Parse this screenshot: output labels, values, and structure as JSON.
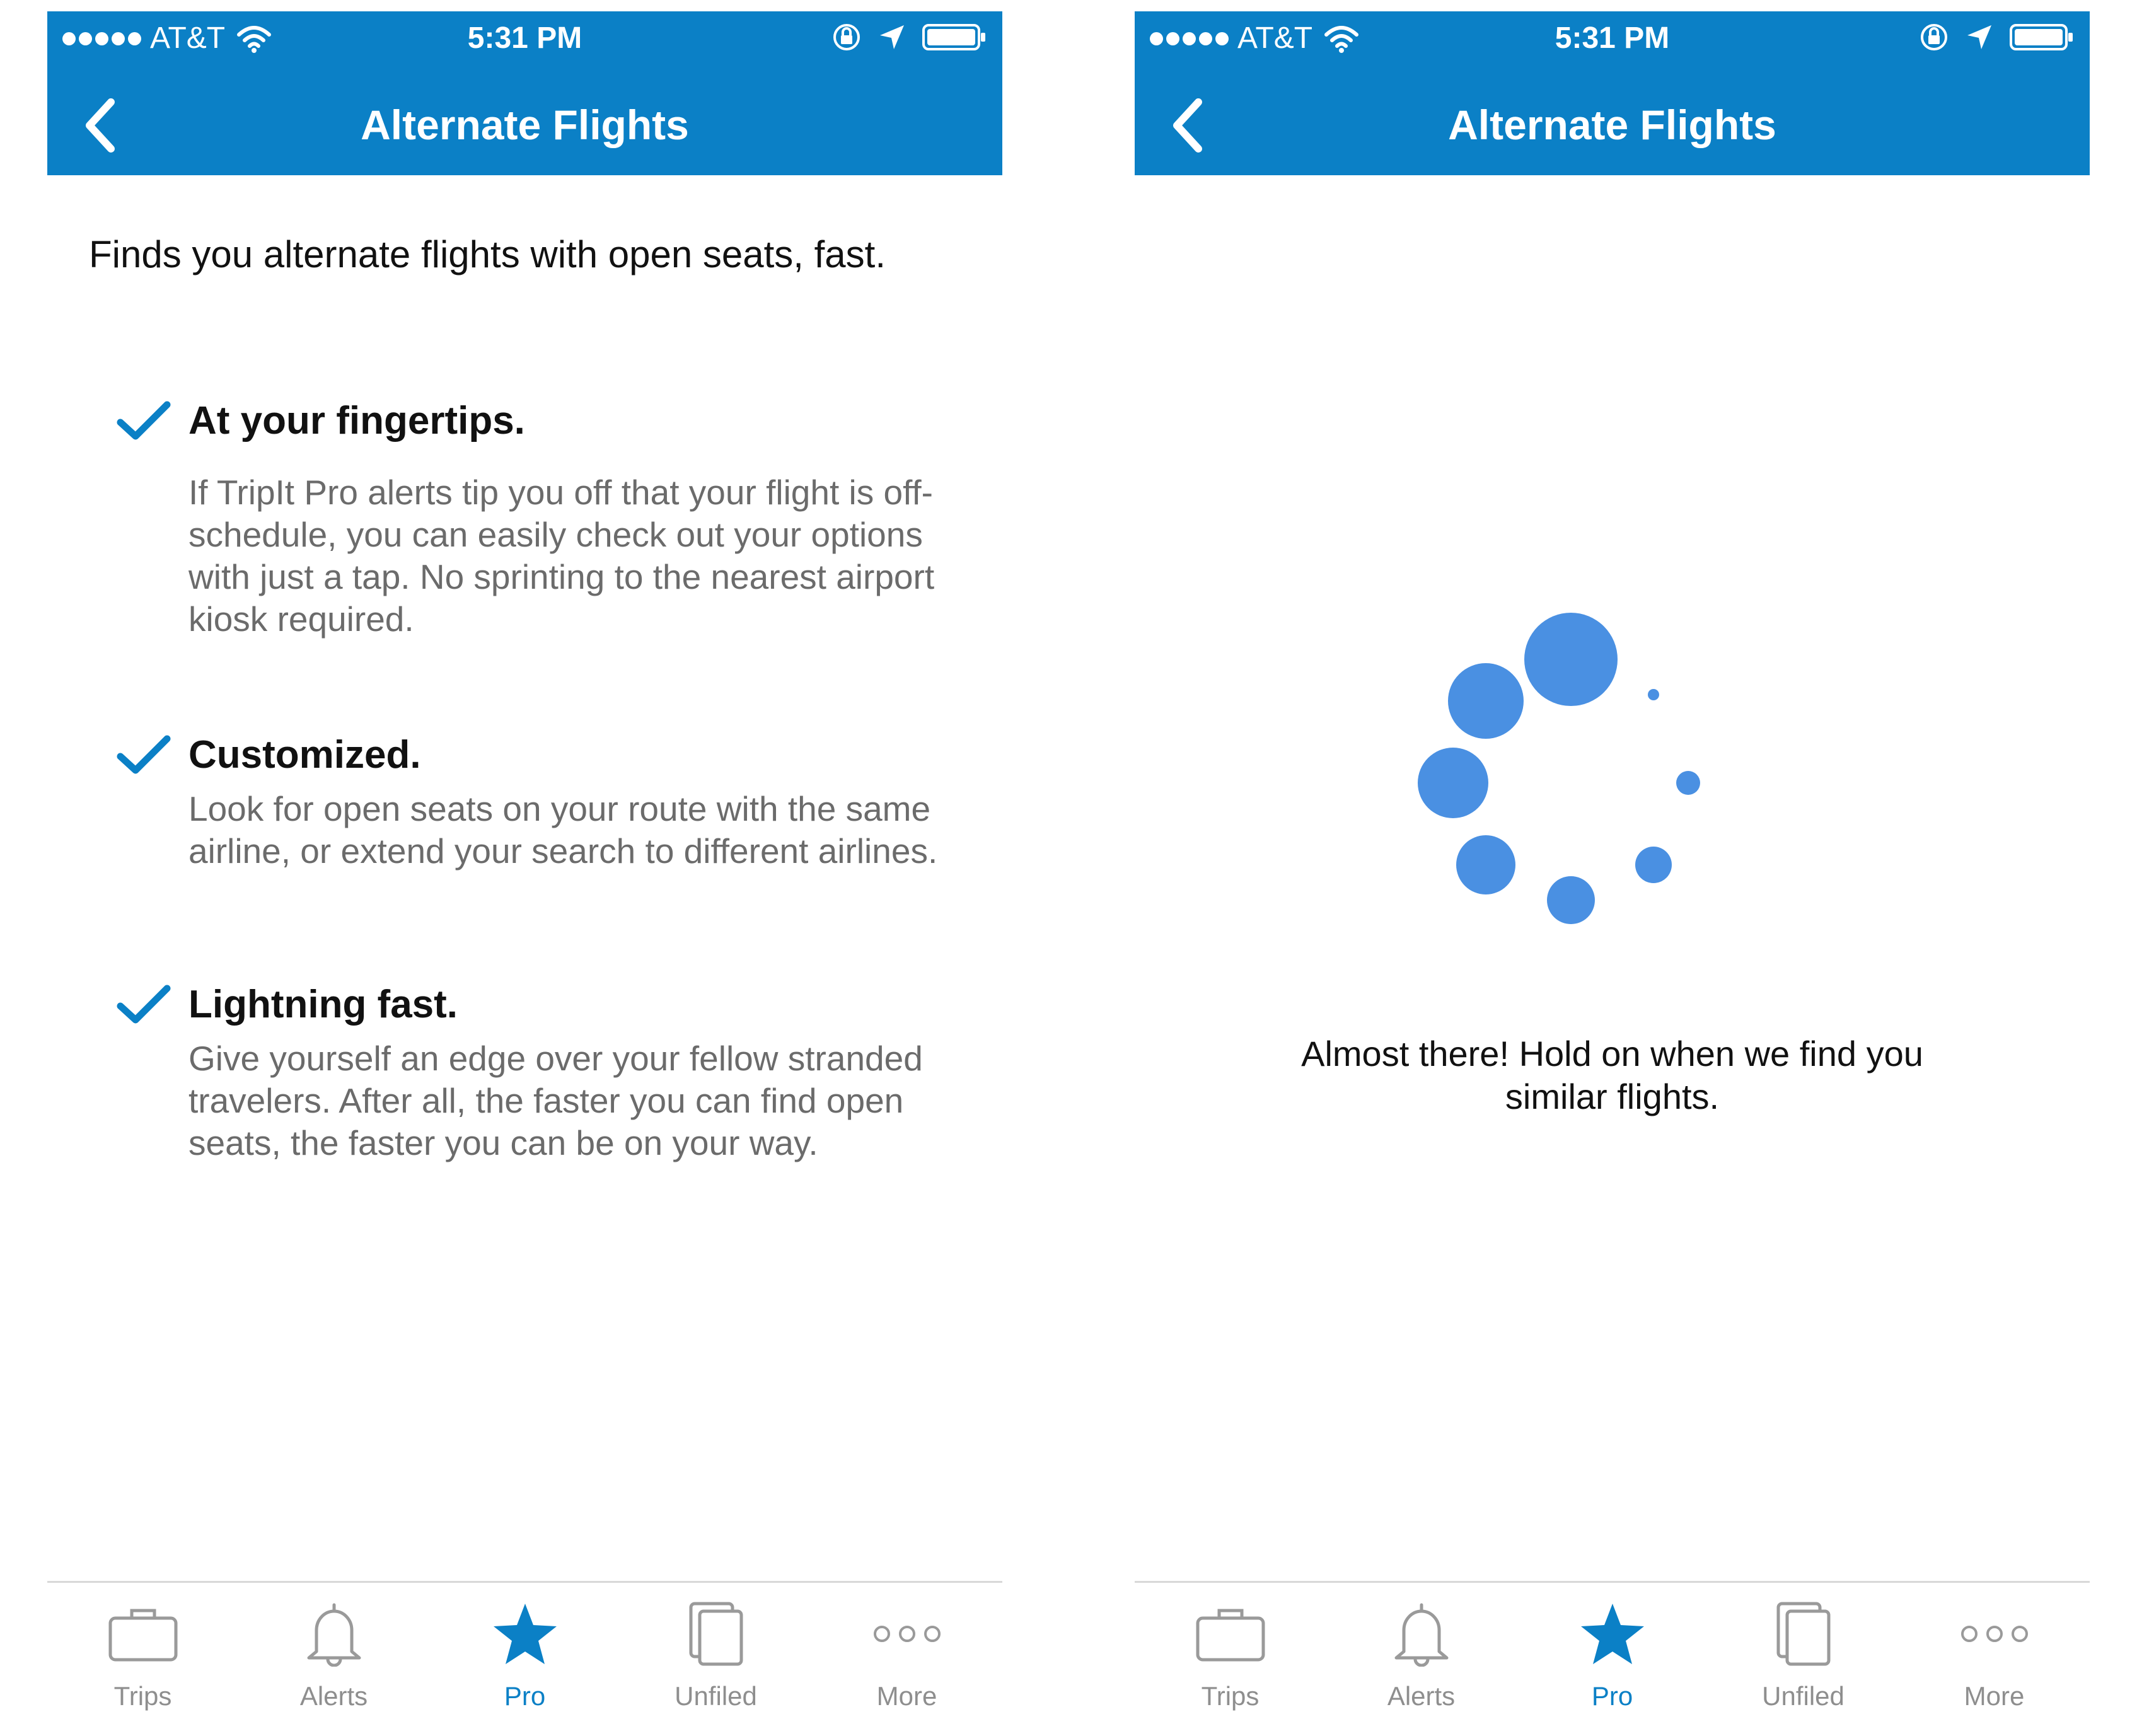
{
  "status_bar": {
    "carrier": "AT&T",
    "time": "5:31 PM"
  },
  "nav": {
    "title": "Alternate Flights"
  },
  "intro": {
    "text": "Finds you alternate flights with open seats, fast."
  },
  "features": [
    {
      "title": "At your fingertips.",
      "description": "If TripIt Pro alerts tip you off that your flight is off-schedule, you can easily check out your options with just a tap.  No sprinting to the nearest airport kiosk required."
    },
    {
      "title": "Customized.",
      "description": "Look for open seats on your route with the same airline, or extend your search to different airlines."
    },
    {
      "title": "Lightning fast.",
      "description": "Give yourself an edge over your fellow stranded travelers. After all, the faster you can find open seats, the faster you can be on your way."
    }
  ],
  "loading": {
    "message": "Almost there! Hold on when we find you similar flights."
  },
  "tab_bar": {
    "items": [
      {
        "label": "Trips",
        "icon": "briefcase-icon",
        "active": false
      },
      {
        "label": "Alerts",
        "icon": "bell-icon",
        "active": false
      },
      {
        "label": "Pro",
        "icon": "star-icon",
        "active": true
      },
      {
        "label": "Unfiled",
        "icon": "documents-icon",
        "active": false
      },
      {
        "label": "More",
        "icon": "ellipsis-icon",
        "active": false
      }
    ]
  },
  "colors": {
    "header_blue": "#0B80C6",
    "spinner_blue": "#4A90E2",
    "inactive_gray": "#8E8E8E"
  }
}
